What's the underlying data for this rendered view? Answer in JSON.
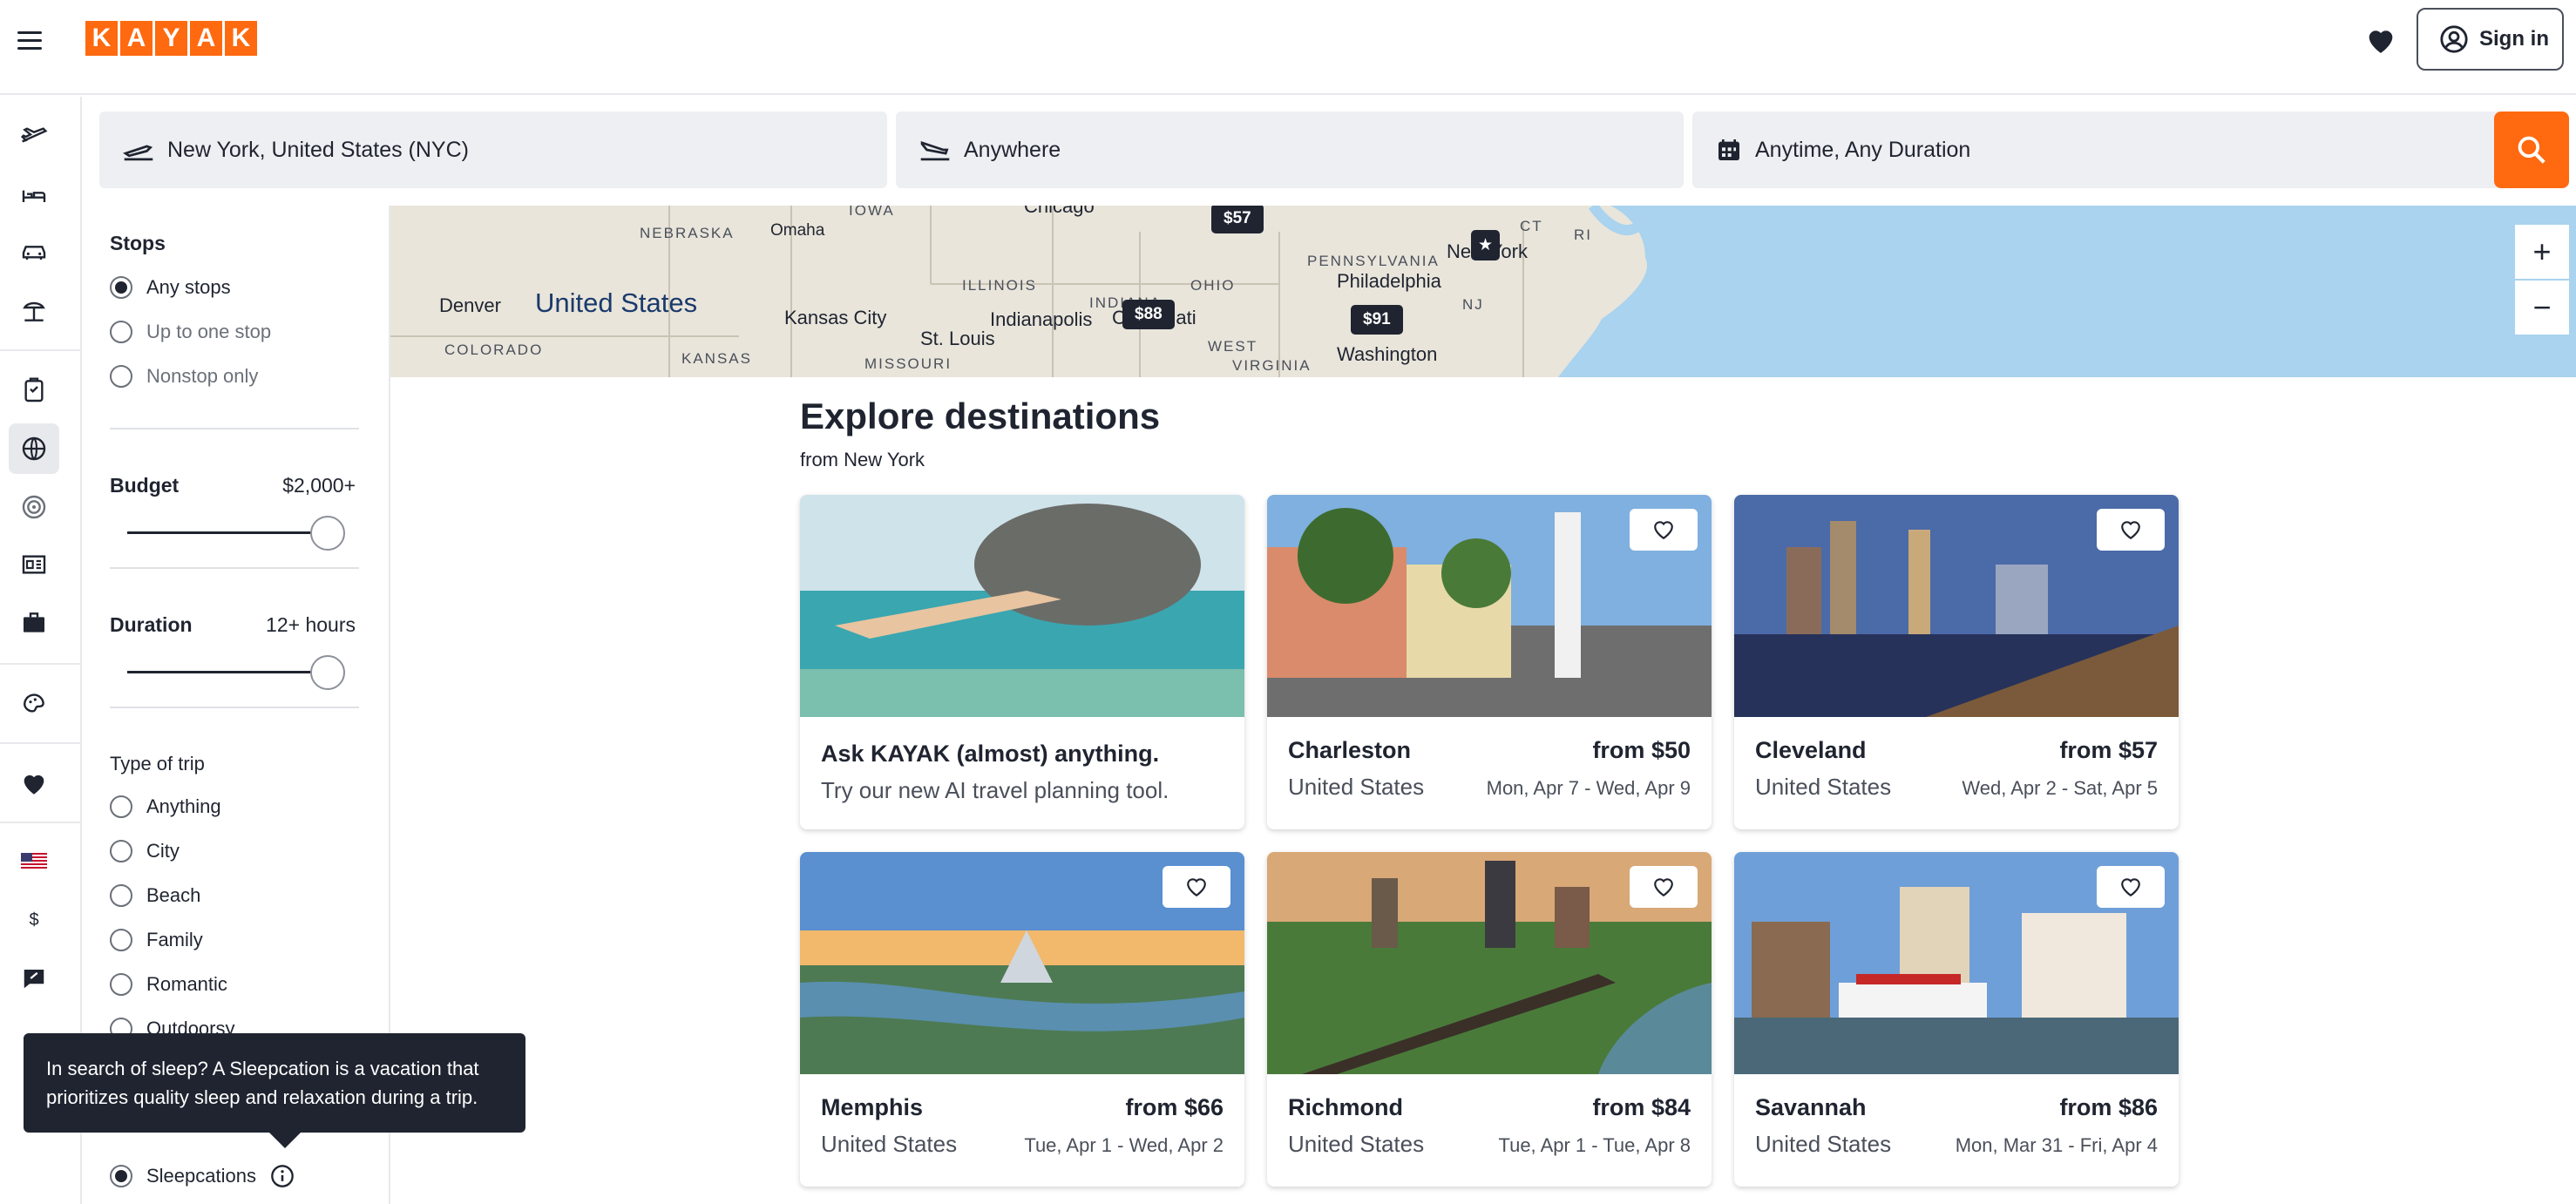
{
  "app": {
    "logo_letters": [
      "K",
      "A",
      "Y",
      "A",
      "K"
    ],
    "sign_in": "Sign in",
    "brand_color": "#ff690f"
  },
  "search": {
    "origin": "New York, United States (NYC)",
    "destination": "Anywhere",
    "dates": "Anytime, Any Duration"
  },
  "rail": {
    "icons": [
      "flights-icon",
      "stays-icon",
      "cars-icon",
      "packages-icon",
      "trips-icon",
      "explore-icon",
      "best-time-icon",
      "hacker-fares-icon",
      "business-icon",
      "deals-icon",
      "saved-icon",
      "us-flag-icon",
      "currency-icon",
      "feedback-icon"
    ],
    "currency": "$"
  },
  "filters": {
    "stops": {
      "title": "Stops",
      "options": [
        "Any stops",
        "Up to one stop",
        "Nonstop only"
      ]
    },
    "budget": {
      "title": "Budget",
      "value": "$2,000+",
      "level": 1.0
    },
    "duration": {
      "title": "Duration",
      "value": "12+ hours",
      "level": 1.0
    },
    "trip_type": {
      "title": "Type of trip",
      "options": [
        "Anything",
        "City",
        "Beach",
        "Family",
        "Romantic",
        "Outdoorsy"
      ],
      "selected_extra": "Sleepcations"
    },
    "tooltip": "In search of sleep? A Sleepcation is a vacation that prioritizes quality sleep and relaxation during a trip."
  },
  "map": {
    "pins": [
      "$57",
      "$88",
      "$91"
    ],
    "labels": {
      "iowa": "IOWA",
      "chicago": "Chicago",
      "nebraska": "NEBRASKA",
      "omaha": "Omaha",
      "illinois": "ILLINOIS",
      "indiana": "INDIANA",
      "ohio": "OHIO",
      "pennsylvania": "PENNSYLVANIA",
      "new_york": "New York",
      "philadelphia": "Philadelphia",
      "ct": "CT",
      "ri": "RI",
      "nj": "NJ",
      "denver": "Denver",
      "united_states": "United States",
      "kansas_city": "Kansas City",
      "indianapolis": "Indianapolis",
      "cincinnati": "Cincinnati",
      "st_louis": "St. Louis",
      "colorado": "COLORADO",
      "kansas": "KANSAS",
      "missouri": "MISSOURI",
      "west_virginia": "WEST",
      "virginia": "VIRGINIA",
      "washington": "Washington"
    },
    "zoom_in": "+",
    "zoom_out": "−"
  },
  "explore": {
    "title": "Explore destinations",
    "subtitle": "from New York"
  },
  "ai_card": {
    "title": "Ask KAYAK (almost) anything.",
    "subtitle": "Try our new AI travel planning tool."
  },
  "destinations": [
    {
      "city": "Charleston",
      "country": "United States",
      "price": "from $50",
      "dates": "Mon, Apr 7 - Wed, Apr 9"
    },
    {
      "city": "Cleveland",
      "country": "United States",
      "price": "from $57",
      "dates": "Wed, Apr 2 - Sat, Apr 5"
    },
    {
      "city": "Memphis",
      "country": "United States",
      "price": "from $66",
      "dates": "Tue, Apr 1 - Wed, Apr 2"
    },
    {
      "city": "Richmond",
      "country": "United States",
      "price": "from $84",
      "dates": "Tue, Apr 1 - Tue, Apr 8"
    },
    {
      "city": "Savannah",
      "country": "United States",
      "price": "from $86",
      "dates": "Mon, Mar 31 - Fri, Apr 4"
    }
  ]
}
